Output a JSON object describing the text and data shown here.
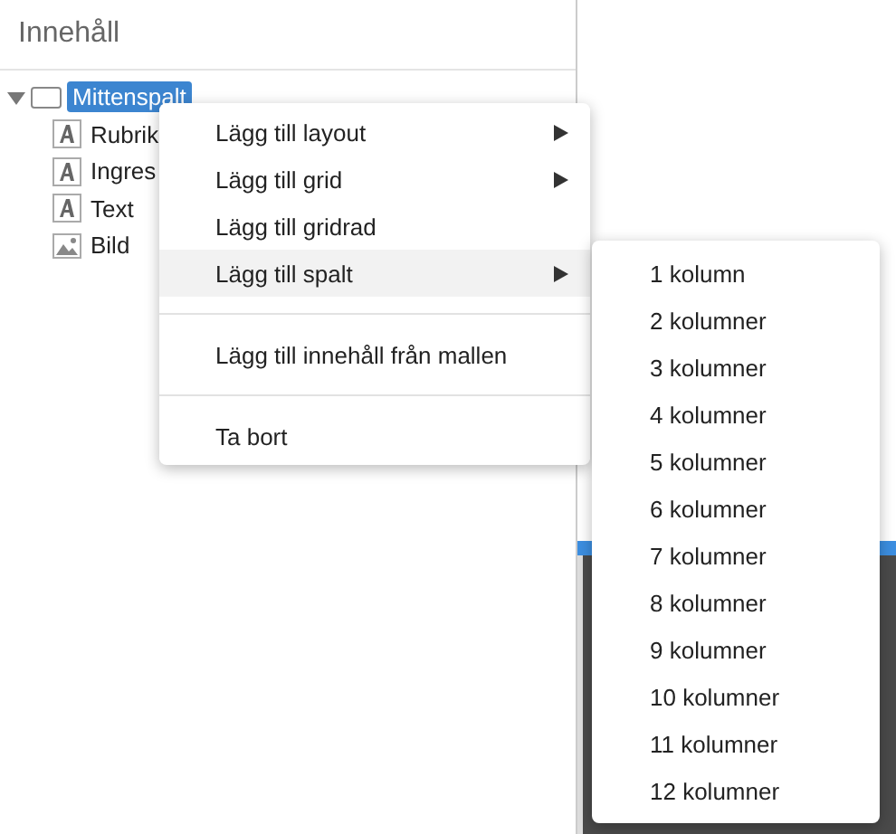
{
  "panel": {
    "title": "Innehåll"
  },
  "tree": {
    "label": "Mittenspalt",
    "expanded": true,
    "selected": true,
    "children": [
      {
        "label": "Rubrik",
        "kind": "text"
      },
      {
        "label": "Ingres",
        "kind": "text"
      },
      {
        "label": "Text",
        "kind": "text"
      },
      {
        "label": "Bild",
        "kind": "image"
      }
    ]
  },
  "context_menu": {
    "groups": [
      [
        {
          "label": "Lägg till layout",
          "submenu": true,
          "highlighted": false
        },
        {
          "label": "Lägg till grid",
          "submenu": true,
          "highlighted": false
        },
        {
          "label": "Lägg till gridrad",
          "submenu": false,
          "highlighted": false
        },
        {
          "label": "Lägg till spalt",
          "submenu": true,
          "highlighted": true
        }
      ],
      [
        {
          "label": "Lägg till innehåll från mallen",
          "submenu": false,
          "highlighted": false
        }
      ],
      [
        {
          "label": "Ta bort",
          "submenu": false,
          "highlighted": false
        }
      ]
    ]
  },
  "submenu": {
    "items": [
      "1 kolumn",
      "2 kolumner",
      "3 kolumner",
      "4 kolumner",
      "5 kolumner",
      "6 kolumner",
      "7 kolumner",
      "8 kolumner",
      "9 kolumner",
      "10 kolumner",
      "11 kolumner",
      "12 kolumner"
    ]
  }
}
